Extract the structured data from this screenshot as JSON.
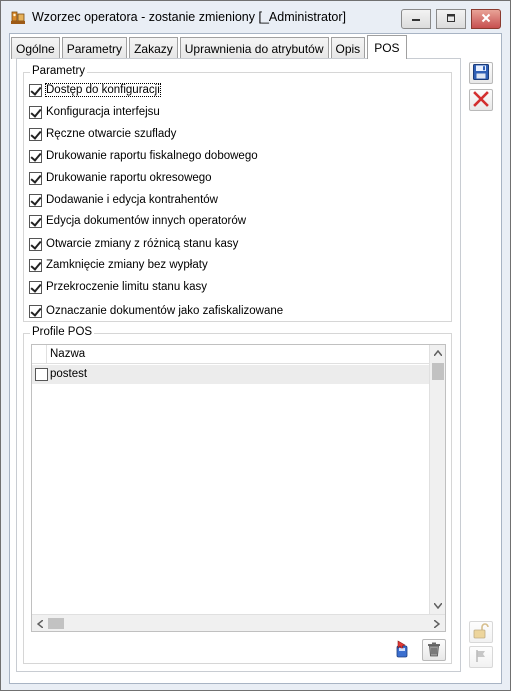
{
  "window": {
    "title": "Wzorzec operatora - zostanie zmieniony [_Administrator]"
  },
  "tabs": [
    {
      "label": "Ogólne"
    },
    {
      "label": "Parametry"
    },
    {
      "label": "Zakazy"
    },
    {
      "label": "Uprawnienia do atrybutów"
    },
    {
      "label": "Opis"
    },
    {
      "label": "POS",
      "active": true
    }
  ],
  "parametry": {
    "legend": "Parametry",
    "items": [
      {
        "label": "Dostęp do konfiguracji",
        "checked": true
      },
      {
        "label": "Konfiguracja interfejsu",
        "checked": true
      },
      {
        "label": "Ręczne otwarcie szuflady",
        "checked": true
      },
      {
        "label": "Drukowanie raportu fiskalnego dobowego",
        "checked": true
      },
      {
        "label": "Drukowanie raportu okresowego",
        "checked": true
      },
      {
        "label": "Dodawanie i edycja kontrahentów",
        "checked": true
      },
      {
        "label": "Edycja dokumentów innych operatorów",
        "checked": true
      },
      {
        "label": "Otwarcie zmiany z różnicą stanu kasy",
        "checked": true
      },
      {
        "label": "Zamknięcie zmiany bez wypłaty",
        "checked": true
      },
      {
        "label": "Przekroczenie limitu stanu kasy",
        "checked": true
      },
      {
        "label": "Oznaczanie dokumentów jako zafiskalizowane",
        "checked": true
      }
    ]
  },
  "profile_pos": {
    "legend": "Profile POS",
    "column_header": "Nazwa",
    "rows": [
      {
        "name": "postest",
        "checked": false
      }
    ]
  },
  "icons": {
    "save": "save-icon",
    "cancel": "cancel-icon",
    "add_profile": "add-profile-icon",
    "delete": "trash-icon",
    "lock": "lock-icon",
    "flag": "flag-icon"
  },
  "colors": {
    "window_bg": "#e9eef5",
    "close_button": "#c75050",
    "cancel_red": "#d32f2f",
    "save_blue": "#2f5fb5"
  }
}
